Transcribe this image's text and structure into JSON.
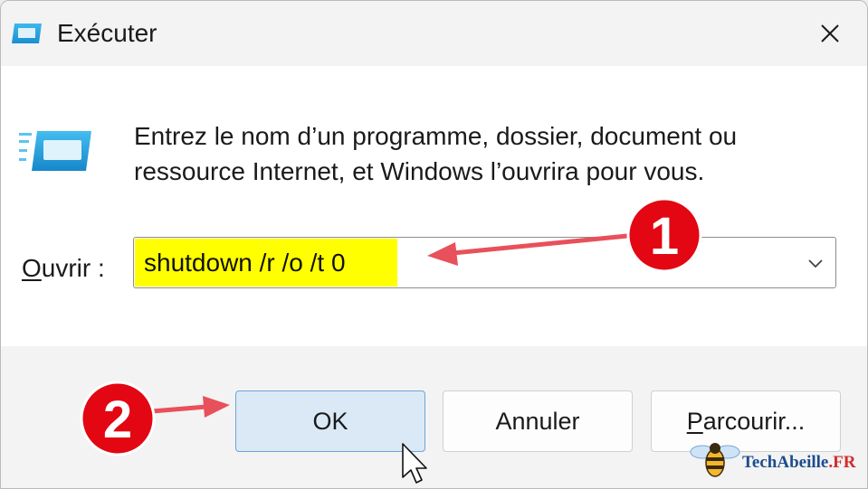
{
  "window": {
    "title": "Exécuter",
    "close_glyph": "✕"
  },
  "content": {
    "description_line1": "Entrez le nom d’un programme, dossier, document ou",
    "description_line2": "ressource Internet, et Windows l’ouvrira pour vous.",
    "open_label_accel": "O",
    "open_label_rest": "uvrir :",
    "command_value": "shutdown /r /o /t 0"
  },
  "buttons": {
    "ok": "OK",
    "cancel": "Annuler",
    "browse_accel": "P",
    "browse_rest": "arcourir..."
  },
  "annotations": {
    "step1": "1",
    "step2": "2",
    "arrow_color": "#e8505b",
    "badge_color": "#e30613",
    "highlight_color": "#ffff00"
  },
  "watermark": {
    "brand": "TechAbeille",
    "tld": ".FR"
  },
  "icons": {
    "app_icon": "run-dialog-icon",
    "close": "close-icon",
    "chevron": "chevron-down-icon",
    "cursor": "mouse-pointer-icon",
    "logo": "bee-logo-icon"
  },
  "colors": {
    "accent": "#0078d4",
    "ok_button_bg": "#dbe9f6",
    "ok_button_border": "#6fa4d6"
  }
}
